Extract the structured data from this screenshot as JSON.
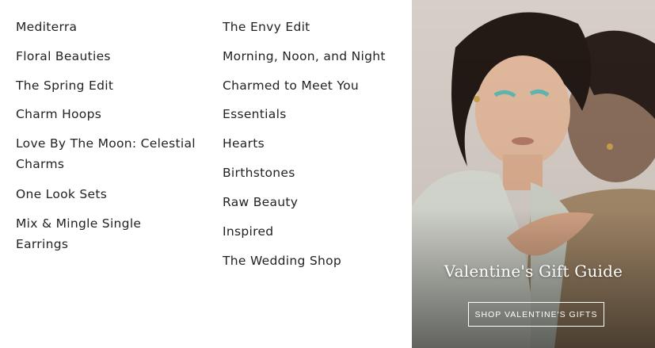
{
  "menu": {
    "column_1": [
      "Mediterra",
      "Floral Beauties",
      "The Spring Edit",
      "Charm Hoops",
      "Love By The Moon: Celestial Charms",
      "One Look Sets",
      "Mix & Mingle Single Earrings"
    ],
    "column_2": [
      "The Envy Edit",
      "Morning, Noon, and Night",
      "Charmed to Meet You",
      "Essentials",
      "Hearts",
      "Birthstones",
      "Raw Beauty",
      "Inspired",
      "The Wedding Shop"
    ]
  },
  "feature": {
    "title": "Valentine's Gift Guide",
    "button_label": "SHOP VALENTINE'S GIFTS"
  },
  "colors": {
    "text": "#222222",
    "button_border": "#ffffff"
  }
}
